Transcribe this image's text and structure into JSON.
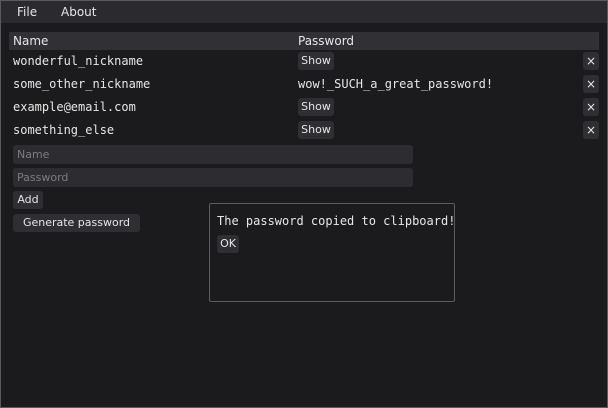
{
  "menu": [
    {
      "label": "File"
    },
    {
      "label": "About"
    }
  ],
  "table": {
    "headers": {
      "name": "Name",
      "password": "Password"
    },
    "rows": [
      {
        "name": "wonderful_nickname",
        "password": "",
        "show_label": "Show",
        "delete_label": "×"
      },
      {
        "name": "some_other_nickname",
        "password": "wow!_SUCH_a_great_password!",
        "show_label": "",
        "delete_label": "×"
      },
      {
        "name": "example@email.com",
        "password": "",
        "show_label": "Show",
        "delete_label": "×"
      },
      {
        "name": "something_else",
        "password": "",
        "show_label": "Show",
        "delete_label": "×"
      }
    ]
  },
  "form": {
    "name_placeholder": "Name",
    "password_placeholder": "Password",
    "add_label": "Add",
    "generate_label": "Generate password"
  },
  "popup": {
    "message": "The password copied to clipboard!",
    "ok_label": "OK"
  }
}
